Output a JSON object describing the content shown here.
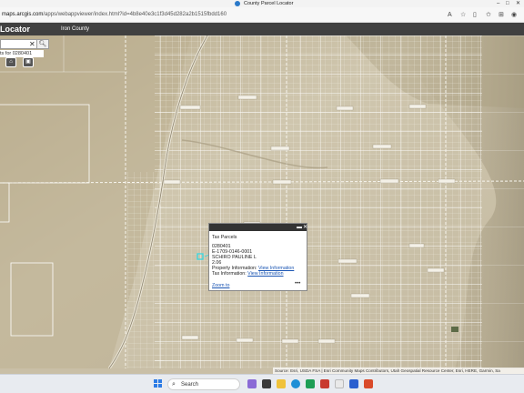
{
  "browser": {
    "tab_title": "County Parcel Locator",
    "url_host": "maps.arcgis.com",
    "url_path": "/apps/webappviewer/index.html?id=4b8e40e3c1f3d45d282a2b1515fbdd160"
  },
  "app": {
    "name": "Locator",
    "county": "Iron County"
  },
  "search": {
    "clear_glyph": "✕",
    "result_text": "ts for 0280401"
  },
  "popup": {
    "layer_title": "Tax Parcels",
    "parcel_id": "0280401",
    "account": "E-1709-0146-0001",
    "owner": "SCHIRO PAULINE L",
    "acres": "2.06",
    "property_label": "Property Information:",
    "property_link": "View Information",
    "tax_label": "Tax Information:",
    "tax_link": "View Information",
    "zoom_link": "Zoom to",
    "more_glyph": "•••"
  },
  "attribution": "Source: Esri, USDA FSA | Esri Community Maps Contributors, Utah Geospatial Resource Center, Esri, HERE, Garmin, Sa",
  "taskbar": {
    "search_placeholder": "Search"
  },
  "icons": {
    "search": "search-icon",
    "clear": "close-icon",
    "start": "windows-start-icon"
  },
  "colors": {
    "header": "#404040",
    "parcel_lines": "#ffffff",
    "selection": "#38d6e0",
    "terrain": "#c8bea6"
  }
}
